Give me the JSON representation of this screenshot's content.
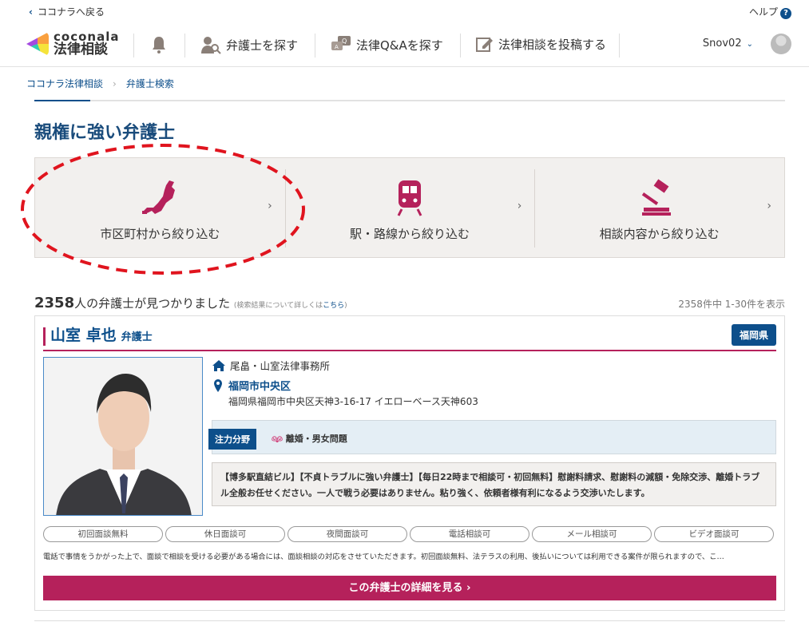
{
  "top": {
    "back_label": "ココナラへ戻る",
    "help_label": "ヘルプ",
    "help_icon": "?"
  },
  "header": {
    "logo_en": "coconala",
    "logo_jp": "法律相談",
    "nav": [
      "弁護士を探す",
      "法律Q&Aを探す",
      "法律相談を投稿する"
    ],
    "user": "Snov02"
  },
  "breadcrumb": [
    "ココナラ法律相談",
    "弁護士検索"
  ],
  "page_title": "親権に強い弁護士",
  "filters": [
    "市区町村から絞り込む",
    "駅・路線から絞り込む",
    "相談内容から絞り込む"
  ],
  "results": {
    "count": "2358",
    "count_suffix": "人の弁護士が見つかりました",
    "note_prefix": "(検索結果について詳しくは",
    "note_link": "こちら",
    "note_suffix": ")",
    "range": "2358件中 1-30件を表示"
  },
  "lawyer": {
    "name": "山室 卓也",
    "title": "弁護士",
    "prefecture": "福岡県",
    "office": "尾畠・山室法律事務所",
    "area": "福岡市中央区",
    "address": "福岡県福岡市中央区天神3-16-17 イエローベース天神603",
    "focus_label": "注力分野",
    "focus": "離婚・男女問題",
    "pr": "【博多駅直結ビル】【不貞トラブルに強い弁護士】【毎日22時まで相談可・初回無料】慰謝料請求、慰謝料の減額・免除交渉、離婚トラブル全般お任せください。一人で戦う必要はありません。粘り強く、依頼者様有利になるよう交渉いたします。",
    "features": [
      "初回面談無料",
      "休日面談可",
      "夜間面談可",
      "電話相談可",
      "メール相談可",
      "ビデオ面談可"
    ],
    "description": "電話で事情をうかがった上で、面談で相談を受ける必要がある場合には、面談相談の対応をさせていただきます。初回面談無料、法テラスの利用、後払いについては利用できる案件が限られますので、こ…",
    "detail_button": "この弁護士の詳細を見る ›"
  },
  "colors": {
    "brand": "#b5215b",
    "blue": "#0d4f8b",
    "annotation": "#e0141e"
  }
}
